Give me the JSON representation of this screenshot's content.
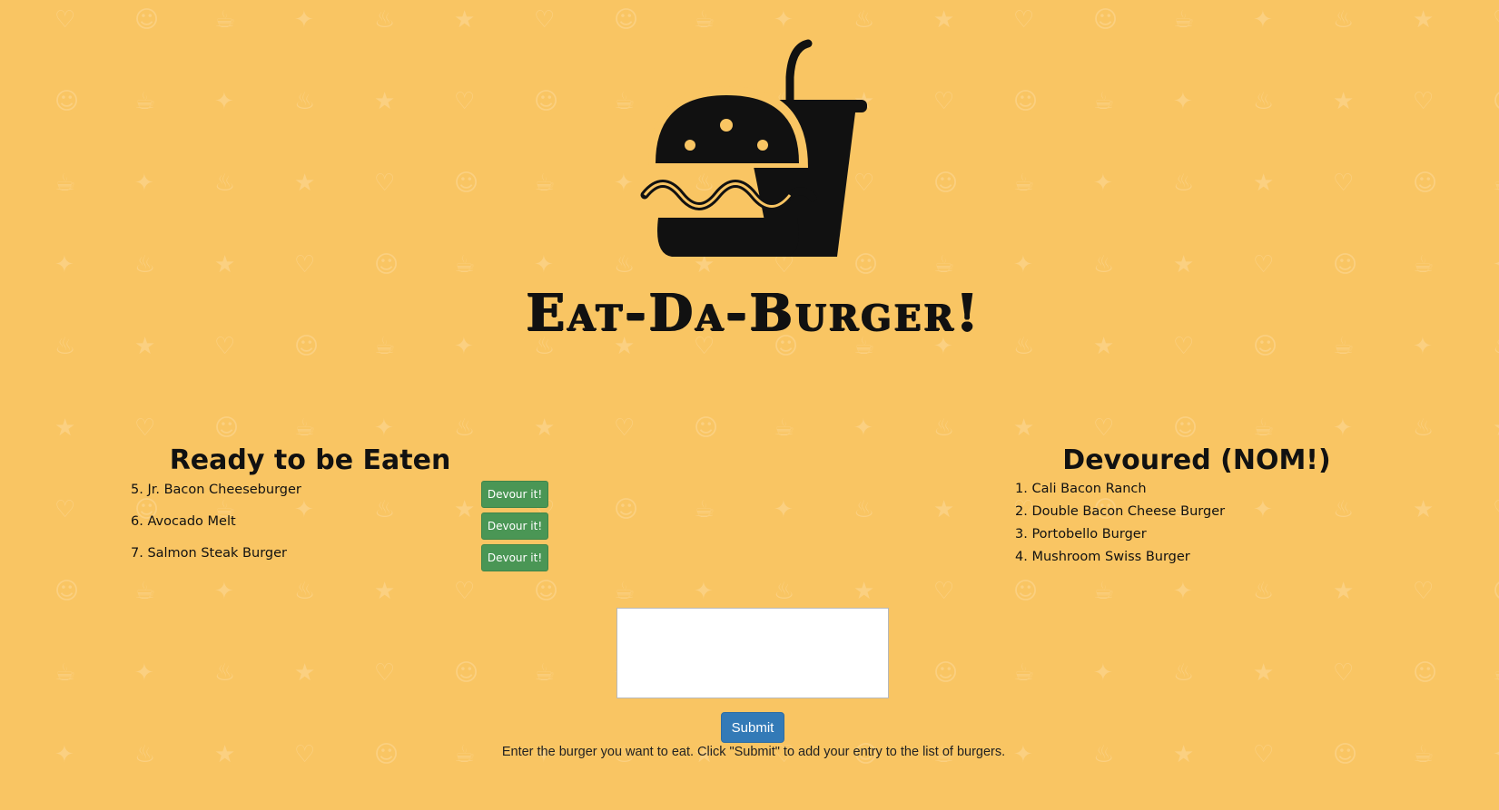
{
  "header": {
    "logo_icon": "burger-and-drink-icon",
    "title": "Eat-Da-Burger!"
  },
  "ready": {
    "heading": "Ready to be Eaten",
    "button_label": "Devour it!",
    "items": [
      {
        "label": "5. Jr. Bacon Cheeseburger"
      },
      {
        "label": "6. Avocado Melt"
      },
      {
        "label": "7. Salmon Steak Burger"
      }
    ]
  },
  "devoured": {
    "heading": "Devoured (NOM!)",
    "items": [
      {
        "label": "1. Cali Bacon Ranch"
      },
      {
        "label": "2. Double Bacon Cheese Burger"
      },
      {
        "label": "3. Portobello Burger"
      },
      {
        "label": "4. Mushroom Swiss Burger"
      }
    ]
  },
  "form": {
    "input_value": "",
    "submit_label": "Submit",
    "help_text": "Enter the burger you want to eat. Click \"Submit\" to add your entry to the list of burgers."
  },
  "colors": {
    "background": "#f9c563",
    "devour_button": "#4a9655",
    "submit_button": "#337ab7"
  }
}
